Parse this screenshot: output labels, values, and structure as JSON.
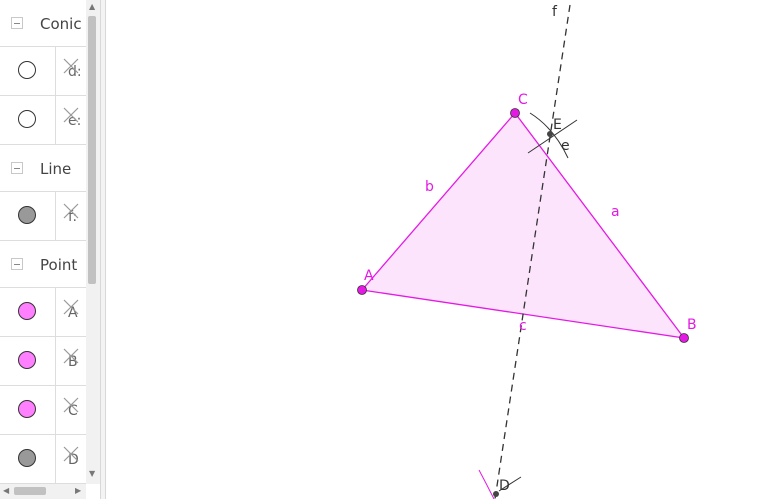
{
  "algebra": {
    "groups": [
      {
        "title": "Conic",
        "items": [
          {
            "name": "d:",
            "fill": "#ffffff"
          },
          {
            "name": "e:",
            "fill": "#ffffff"
          }
        ]
      },
      {
        "title": "Line",
        "items": [
          {
            "name": "f:",
            "fill": "#999999"
          }
        ]
      },
      {
        "title": "Point",
        "items": [
          {
            "name": "A",
            "fill": "#ff80ff"
          },
          {
            "name": "B",
            "fill": "#ff80ff"
          },
          {
            "name": "C",
            "fill": "#ff80ff"
          },
          {
            "name": "D",
            "fill": "#999999"
          }
        ]
      }
    ]
  },
  "graphics": {
    "colors": {
      "polygon": "#e41ae4",
      "polygon_fill": "#fde4fd",
      "line": "#333333",
      "point_gray": "#444444"
    },
    "points": {
      "A": "A",
      "B": "B",
      "C": "C",
      "D": "D",
      "E": "E"
    },
    "segments": {
      "a": "a",
      "b": "b",
      "c": "c"
    },
    "line_label": "f",
    "conic_label": "e"
  }
}
